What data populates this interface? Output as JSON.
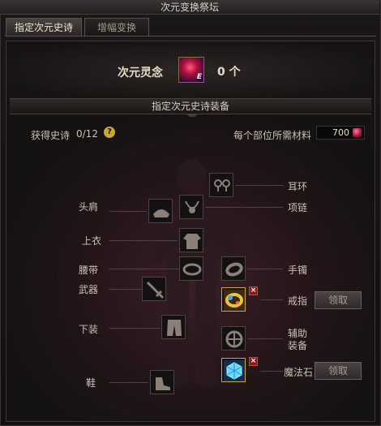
{
  "window": {
    "title": "次元变换祭坛"
  },
  "tabs": [
    {
      "label": "指定次元史诗",
      "active": true
    },
    {
      "label": "增幅变换",
      "active": false
    }
  ],
  "currency": {
    "label": "次元灵念",
    "icon": "dimension-soul-gem-icon",
    "badge": "E",
    "count": "0 个"
  },
  "section": {
    "title": "指定次元史诗装备"
  },
  "stats": {
    "obtained_label": "获得史诗",
    "obtained_count": "0/12",
    "help_icon": "?",
    "material_label": "每个部位所需材料",
    "material_value": "700"
  },
  "slots": {
    "earring": "耳环",
    "shoulder": "头肩",
    "necklace": "项链",
    "top": "上衣",
    "belt": "腰带",
    "bracelet": "手镯",
    "weapon": "武器",
    "ring": "戒指",
    "bottom": "下装",
    "support": "辅助装备",
    "support_line1": "辅助",
    "support_line2": "装备",
    "shoes": "鞋",
    "magic_stone": "魔法石"
  },
  "buttons": {
    "claim": "领取",
    "remove": "×"
  },
  "colors": {
    "accent_gold": "#c9a63c",
    "gem_red": "#b0103a",
    "remove_red": "#8a1a1a"
  }
}
